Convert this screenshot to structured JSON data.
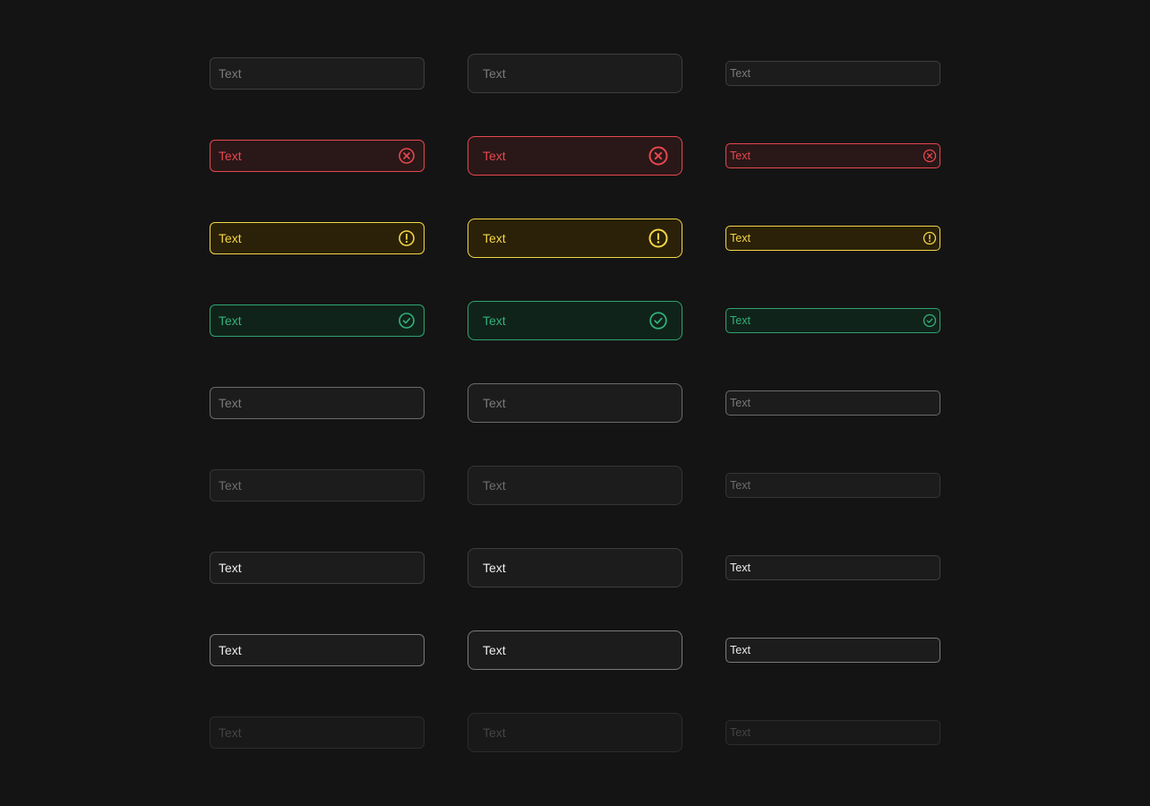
{
  "colors": {
    "background": "#141414",
    "error": "#e5484d",
    "warning": "#f5d547",
    "success": "#33b07a"
  },
  "rows": [
    {
      "state": "default",
      "label": "Text",
      "icon": null
    },
    {
      "state": "error",
      "label": "Text",
      "icon": "circle-x-icon"
    },
    {
      "state": "warning",
      "label": "Text",
      "icon": "circle-exclamation-icon"
    },
    {
      "state": "success",
      "label": "Text",
      "icon": "circle-check-icon"
    },
    {
      "state": "hover",
      "label": "Text",
      "icon": null
    },
    {
      "state": "muted",
      "label": "Text",
      "icon": null
    },
    {
      "state": "filled",
      "label": "Text",
      "icon": null
    },
    {
      "state": "filled-active",
      "label": "Text",
      "icon": null
    },
    {
      "state": "disabled",
      "label": "Text",
      "icon": null
    }
  ]
}
